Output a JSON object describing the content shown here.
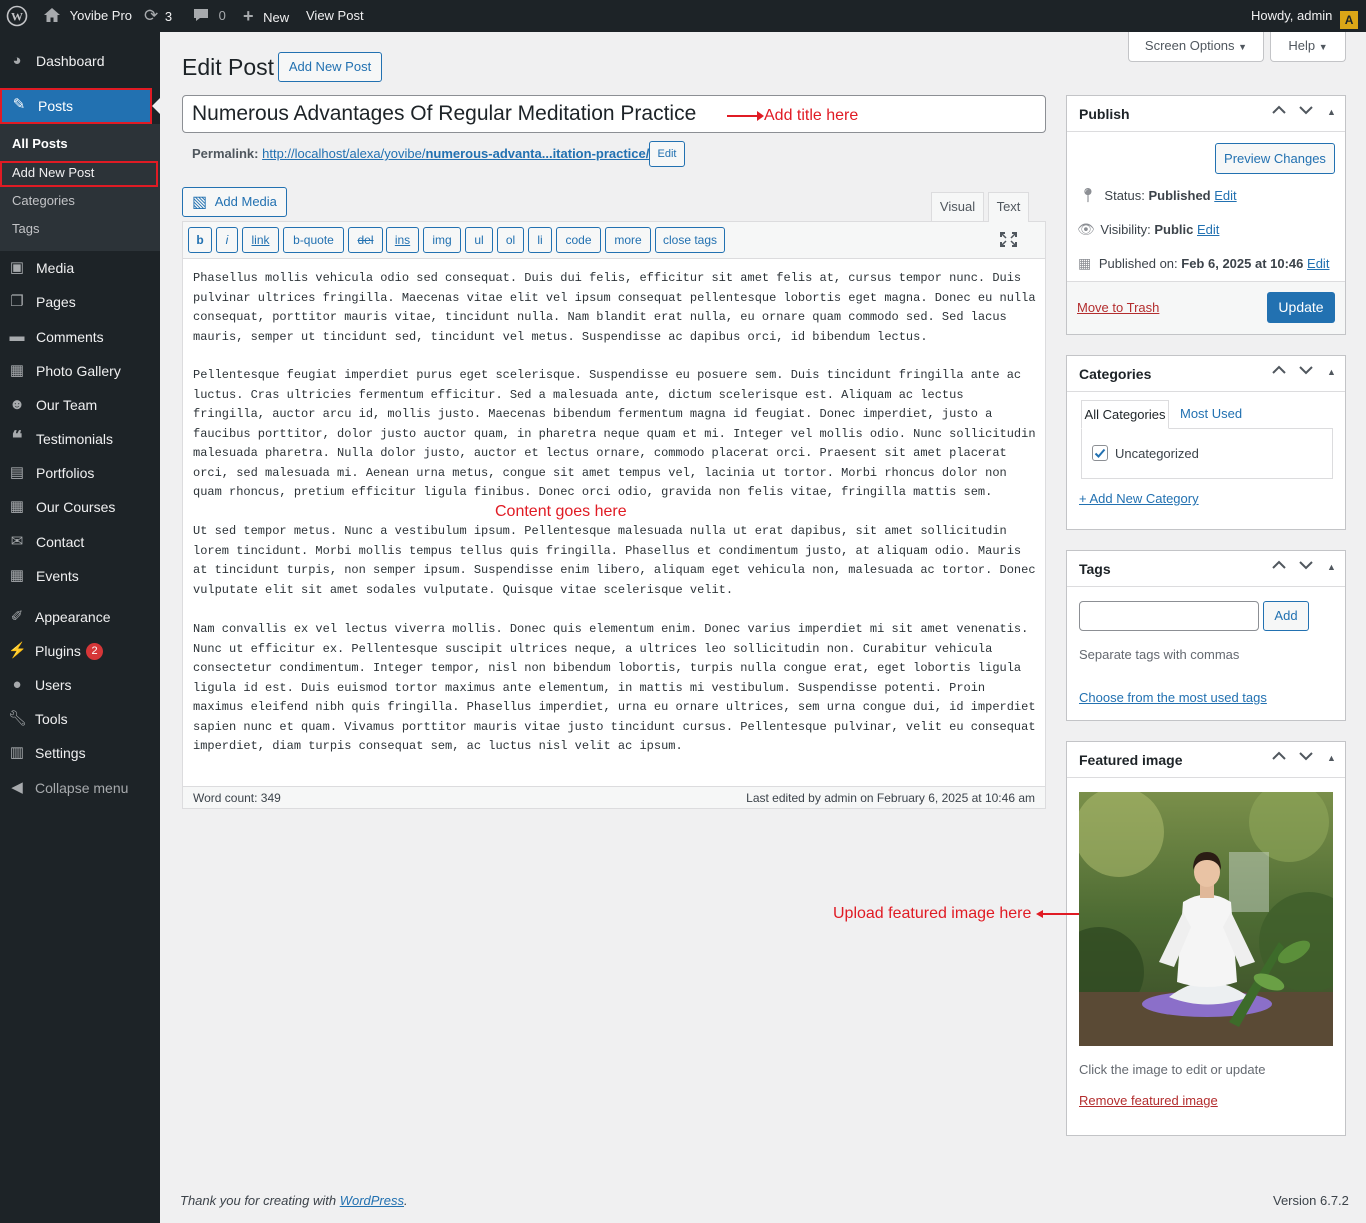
{
  "adminbar": {
    "site": "Yovibe Pro",
    "updates": "3",
    "comments": "0",
    "new": "New",
    "view": "View Post",
    "howdy": "Howdy, admin"
  },
  "menu": {
    "dashboard": "Dashboard",
    "posts": "Posts",
    "sub": [
      "All Posts",
      "Add New Post",
      "Categories",
      "Tags"
    ],
    "items": [
      "Media",
      "Pages",
      "Comments",
      "Photo Gallery",
      "Our Team",
      "Testimonials",
      "Portfolios",
      "Our Courses",
      "Contact",
      "Events",
      "Appearance",
      "Plugins",
      "Users",
      "Tools",
      "Settings",
      "Collapse menu"
    ],
    "plugins_badge": "2"
  },
  "header": {
    "screen_options": "Screen Options",
    "help": "Help",
    "title": "Edit Post",
    "add_new": "Add New Post"
  },
  "post": {
    "title": "Numerous Advantages Of Regular Meditation Practice",
    "permalink_label": "Permalink:",
    "permalink_base": "http://localhost/alexa/yovibe/",
    "permalink_slug": "numerous-advanta...itation-practice/",
    "permalink_edit": "Edit",
    "add_media": "Add Media",
    "tab_visual": "Visual",
    "tab_text": "Text",
    "quicktags": [
      "b",
      "i",
      "link",
      "b-quote",
      "del",
      "ins",
      "img",
      "ul",
      "ol",
      "li",
      "code",
      "more",
      "close tags"
    ],
    "paragraphs": [
      "Phasellus mollis vehicula odio sed consequat. Duis dui felis, efficitur sit amet felis at, cursus tempor nunc. Duis\npulvinar ultrices fringilla. Maecenas vitae elit vel ipsum consequat pellentesque lobortis eget magna. Donec eu nulla\nconsequat, porttitor mauris vitae, tincidunt nulla. Nam blandit erat nulla, eu ornare quam commodo sed. Sed lacus\nmauris, semper ut tincidunt sed, tincidunt vel metus. Suspendisse ac dapibus orci, id bibendum lectus.",
      "Pellentesque feugiat imperdiet purus eget scelerisque. Suspendisse eu posuere sem. Duis tincidunt fringilla ante ac\nluctus. Cras ultricies fermentum efficitur. Sed a malesuada ante, dictum scelerisque est. Aliquam ac lectus\nfringilla, auctor arcu id, mollis justo. Maecenas bibendum fermentum magna id feugiat. Donec imperdiet, justo a\nfaucibus porttitor, dolor justo auctor quam, in pharetra neque quam et mi. Integer vel mollis odio. Nunc sollicitudin\nmalesuada pharetra. Nulla dolor justo, auctor et lectus ornare, commodo placerat orci. Praesent sit amet placerat\norci, sed malesuada mi. Aenean urna metus, congue sit amet tempus vel, lacinia ut tortor. Morbi rhoncus dolor non\nquam rhoncus, pretium efficitur ligula finibus. Donec orci odio, gravida non felis vitae, fringilla mattis sem.",
      "Ut sed tempor metus. Nunc a vestibulum ipsum. Pellentesque malesuada nulla ut erat dapibus, sit amet sollicitudin\nlorem tincidunt. Morbi mollis tempus tellus quis fringilla. Phasellus et condimentum justo, at aliquam odio. Mauris\nat tincidunt turpis, non semper ipsum. Suspendisse enim libero, aliquam eget vehicula non, malesuada ac tortor. Donec\nvulputate elit sit amet sodales vulputate. Quisque vitae scelerisque velit.",
      "Nam convallis ex vel lectus viverra mollis. Donec quis elementum enim. Donec varius imperdiet mi sit amet venenatis.\nNunc ut efficitur ex. Pellentesque suscipit ultrices neque, a ultrices leo sollicitudin non. Curabitur vehicula\nconsectetur condimentum. Integer tempor, nisl non bibendum lobortis, turpis nulla congue erat, eget lobortis ligula\nligula id est. Duis euismod tortor maximus ante elementum, in mattis mi vestibulum. Suspendisse potenti. Proin\nmaximus eleifend nibh quis fringilla. Phasellus imperdiet, urna eu ornare ultrices, sem urna congue dui, id imperdiet\nsapien nunc et quam. Vivamus porttitor mauris vitae justo tincidunt cursus. Pellentesque pulvinar, velit eu consequat\nimperdiet, diam turpis consequat sem, ac luctus nisl velit ac ipsum."
    ],
    "word_count": "Word count: 349",
    "last_edited": "Last edited by admin on February 6, 2025 at 10:46 am"
  },
  "annotations": {
    "title": "Add title here",
    "content": "Content goes here",
    "featured": "Upload featured image here"
  },
  "publish": {
    "title": "Publish",
    "preview": "Preview Changes",
    "status_label": "Status:",
    "status_value": "Published",
    "visibility_label": "Visibility:",
    "visibility_value": "Public",
    "published_label": "Published on:",
    "published_value": "Feb 6, 2025 at 10:46",
    "edit": "Edit",
    "trash": "Move to Trash",
    "update": "Update"
  },
  "categories": {
    "title": "Categories",
    "tab_all": "All Categories",
    "tab_most": "Most Used",
    "items": [
      "Uncategorized"
    ],
    "add_new": "+ Add New Category"
  },
  "tags": {
    "title": "Tags",
    "add": "Add",
    "hint": "Separate tags with commas",
    "choose": "Choose from the most used tags"
  },
  "featured": {
    "title": "Featured image",
    "hint": "Click the image to edit or update",
    "remove": "Remove featured image"
  },
  "footer": {
    "thanks": "Thank you for creating with ",
    "wp_link": "WordPress",
    "version": "Version 6.7.2"
  },
  "colors": {
    "accent": "#2271b1",
    "adminbar": "#1d2327",
    "annotation": "#e01b24"
  }
}
